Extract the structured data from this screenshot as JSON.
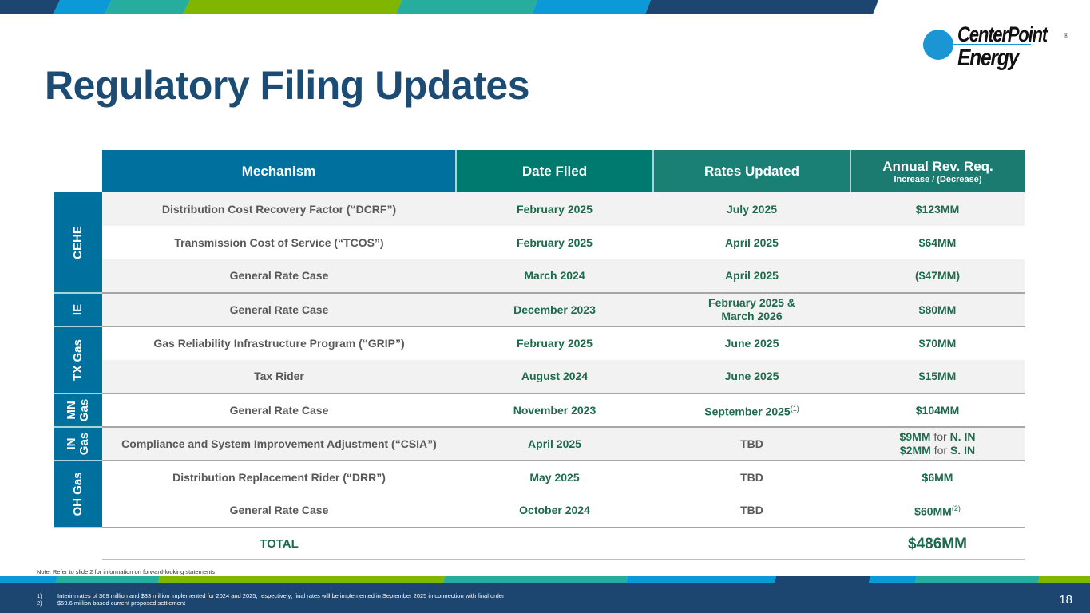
{
  "title": "Regulatory Filing Updates",
  "logo": {
    "line1": "CenterPoint",
    "line2": "Energy",
    "mark": "®"
  },
  "colors": {
    "navy": "#1c4670",
    "blue": "#0b9ad7",
    "teal": "#26ad9d",
    "green": "#80b500",
    "header_blue": "#00709e",
    "value_green": "#1d6a4c"
  },
  "table": {
    "headers": {
      "mechanism": "Mechanism",
      "date_filed": "Date Filed",
      "rates_updated": "Rates Updated",
      "annual": "Annual Rev. Req.",
      "annual_sub": "Increase / (Decrease)"
    },
    "groups": [
      "CEHE",
      "IE",
      "TX Gas",
      "MN Gas",
      "IN Gas",
      "OH Gas"
    ],
    "groups_split": {
      "mn1": "MN",
      "mn2": "Gas",
      "in1": "IN",
      "in2": "Gas"
    },
    "rows": [
      {
        "mechanism": "Distribution Cost Recovery Factor (“DCRF”)",
        "date": "February 2025",
        "rates": "July 2025",
        "rev": "$123MM"
      },
      {
        "mechanism": "Transmission Cost of Service (“TCOS”)",
        "date": "February 2025",
        "rates": "April 2025",
        "rev": "$64MM"
      },
      {
        "mechanism": "General Rate Case",
        "date": "March 2024",
        "rates": "April 2025",
        "rev": "($47MM)"
      },
      {
        "mechanism": "General Rate Case",
        "date": "December 2023",
        "rates": "February 2025 &",
        "rates2": "March 2026",
        "rev": "$80MM"
      },
      {
        "mechanism": "Gas Reliability Infrastructure Program (“GRIP”)",
        "date": "February 2025",
        "rates": "June 2025",
        "rev": "$70MM"
      },
      {
        "mechanism": "Tax Rider",
        "date": "August 2024",
        "rates": "June 2025",
        "rev": "$15MM"
      },
      {
        "mechanism": "General Rate Case",
        "date": "November 2023",
        "rates": "September 2025",
        "rates_sup": "(1)",
        "rev": "$104MM"
      },
      {
        "mechanism": "Compliance and System Improvement Adjustment (“CSIA”)",
        "date": "April 2025",
        "rates": "TBD",
        "rev_a1": "$9MM",
        "rev_for": "for",
        "rev_a2": "N. IN",
        "rev_b1": "$2MM",
        "rev_b2": "S. IN"
      },
      {
        "mechanism": "Distribution Replacement Rider (“DRR”)",
        "date": "May 2025",
        "rates": "TBD",
        "rev": "$6MM"
      },
      {
        "mechanism": "General Rate Case",
        "date": "October 2024",
        "rates": "TBD",
        "rev": "$60MM",
        "rev_sup": "(2)"
      }
    ],
    "total": {
      "label": "TOTAL",
      "value": "$486MM"
    }
  },
  "note": "Note: Refer to slide 2 for information on forward-looking statements",
  "footnotes": [
    {
      "num": "1)",
      "text": "Interim rates of $69 million and $33 million implemented for 2024 and 2025, respectively; final rates will be implemented in September 2025 in connection with final order"
    },
    {
      "num": "2)",
      "text": "$59.6 million based current proposed settlement"
    }
  ],
  "page_number": "18"
}
